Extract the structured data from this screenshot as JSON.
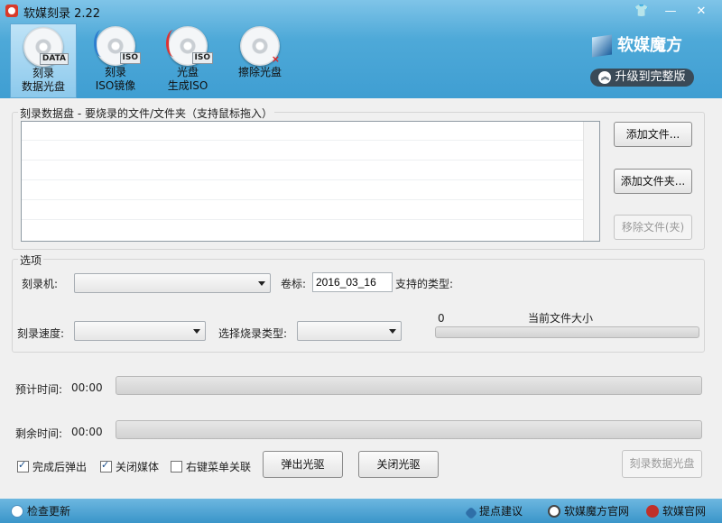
{
  "window": {
    "title": "软媒刻录 2.22"
  },
  "titlebar": {
    "skin_icon": "shirt-icon",
    "minimize": "—",
    "close": "✕"
  },
  "toolbar": {
    "items": [
      {
        "line1": "刻录",
        "line2": "数据光盘",
        "tag": "DATA"
      },
      {
        "line1": "刻录",
        "line2": "ISO镜像",
        "tag": "ISO"
      },
      {
        "line1": "光盘",
        "line2": "生成ISO",
        "tag": "ISO"
      },
      {
        "line1": "擦除光盘",
        "line2": "",
        "tag": "×"
      }
    ]
  },
  "brand": {
    "logo": "软媒魔方",
    "upgrade": "升级到完整版"
  },
  "data_disc": {
    "title": "刻录数据盘 - 要烧录的文件/文件夹（支持鼠标拖入）",
    "add_file": "添加文件...",
    "add_folder": "添加文件夹...",
    "remove_file": "移除文件(夹)"
  },
  "options": {
    "title": "选项",
    "burner_label": "刻录机:",
    "volume_label": "卷标:",
    "volume_value": "2016_03_16",
    "supported_types_label": "支持的类型:",
    "speed_label": "刻录速度:",
    "burn_type_label": "选择烧录类型:",
    "size_value": "0",
    "current_size_label": "当前文件大小"
  },
  "progress": {
    "estimated_label": "预计时间:",
    "estimated_value": "00:00",
    "remaining_label": "剩余时间:",
    "remaining_value": "00:00"
  },
  "bottom": {
    "eject_after": "完成后弹出",
    "close_media": "关闭媒体",
    "context_menu": "右键菜单关联",
    "eject_drive": "弹出光驱",
    "close_drive": "关闭光驱",
    "burn_disc": "刻录数据光盘",
    "eject_after_checked": true,
    "close_media_checked": true,
    "context_menu_checked": false
  },
  "statusbar": {
    "check_update": "检查更新",
    "suggest": "提点建议",
    "ruanmei_official": "软媒魔方官网",
    "site": "软媒官网"
  }
}
